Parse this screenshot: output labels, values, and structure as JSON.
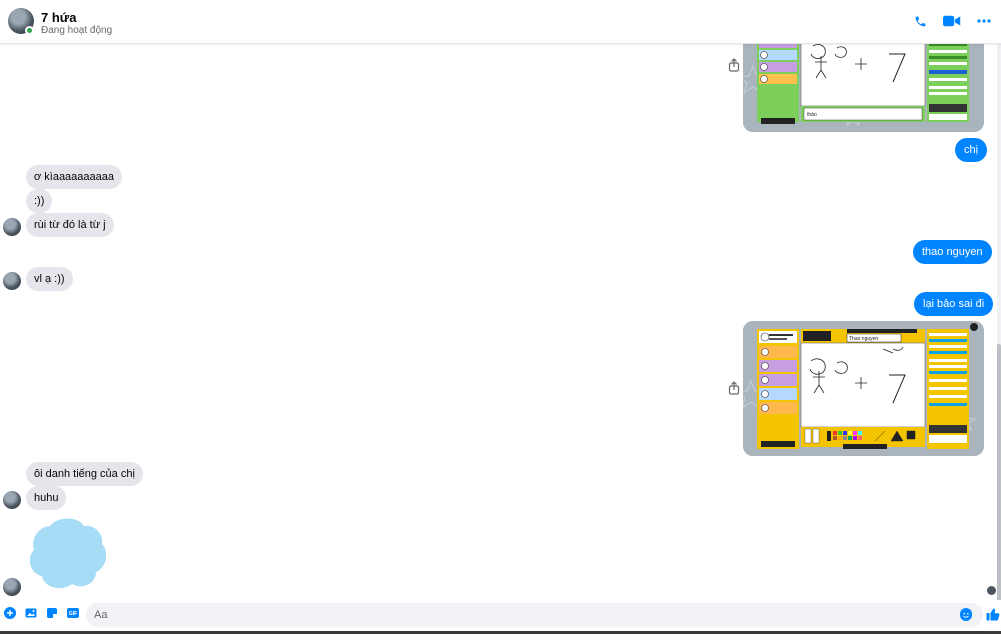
{
  "header": {
    "name": "7 hứa",
    "status": "Đang hoạt động",
    "actions": [
      "phone-icon",
      "video-icon",
      "more-icon"
    ],
    "accent": "#0084ff",
    "online_color": "#31a24c"
  },
  "messages": {
    "out_chi": "chị",
    "in_1": "ơ kìaaaaaaaaaa",
    "in_2": ":))",
    "in_3": "rùi từ đó là từ j",
    "out_thao": "thao nguyen",
    "in_4": "vl ạ :))",
    "out_lai": "lại bảo sai đi",
    "in_5": "ôi danh tiếng của chị",
    "in_6": "huhu"
  },
  "screenshot_top": {
    "answer_text": "thảo"
  },
  "screenshot_bottom": {
    "hint_word": "Thao nguyen"
  },
  "composer": {
    "placeholder": "Aa",
    "icons": [
      "add-icon",
      "image-icon",
      "sticker-icon",
      "gif-icon",
      "emoji-icon",
      "like-icon"
    ],
    "gif_label": "GIF"
  }
}
